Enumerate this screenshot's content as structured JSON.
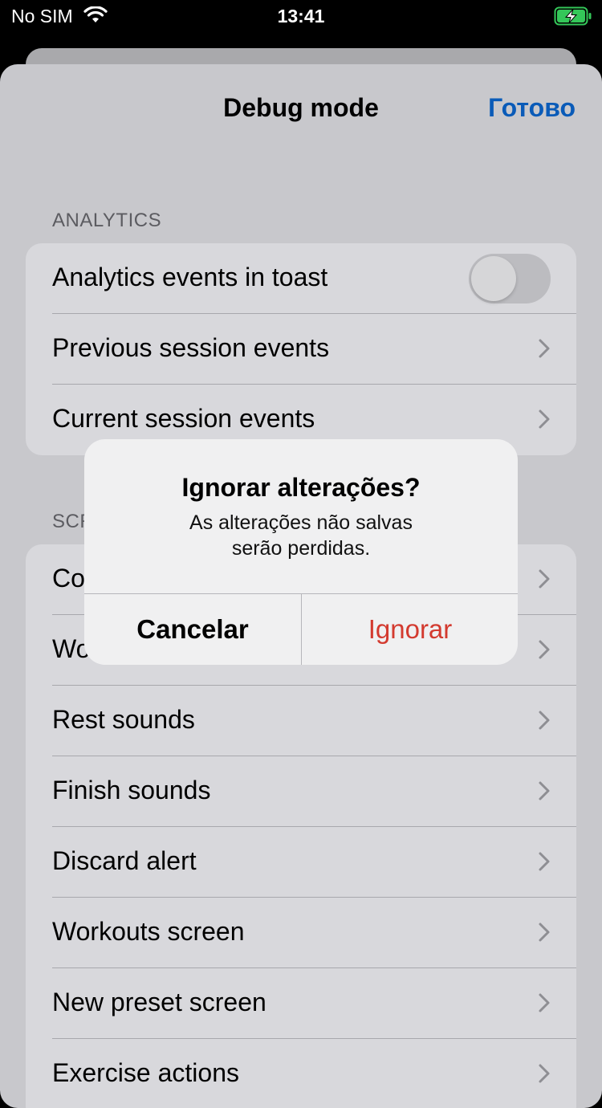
{
  "status_bar": {
    "carrier": "No SIM",
    "time": "13:41"
  },
  "nav": {
    "title": "Debug mode",
    "done_label": "Готово"
  },
  "sections": [
    {
      "header": "ANALYTICS",
      "rows": [
        {
          "label": "Analytics events in toast",
          "accessory": "toggle",
          "toggle_on": false
        },
        {
          "label": "Previous session events",
          "accessory": "chevron"
        },
        {
          "label": "Current session events",
          "accessory": "chevron"
        }
      ]
    },
    {
      "header": "SCR",
      "rows": [
        {
          "label": "Co",
          "accessory": "chevron"
        },
        {
          "label": "Wo",
          "accessory": "chevron"
        },
        {
          "label": "Rest sounds",
          "accessory": "chevron"
        },
        {
          "label": "Finish sounds",
          "accessory": "chevron"
        },
        {
          "label": "Discard alert",
          "accessory": "chevron"
        },
        {
          "label": "Workouts screen",
          "accessory": "chevron"
        },
        {
          "label": "New preset screen",
          "accessory": "chevron"
        },
        {
          "label": "Exercise actions",
          "accessory": "chevron"
        }
      ]
    }
  ],
  "alert": {
    "title": "Ignorar alterações?",
    "message_line1": "As alterações não salvas",
    "message_line2": "serão perdidas.",
    "cancel_label": "Cancelar",
    "ignore_label": "Ignorar"
  },
  "colors": {
    "accent": "#0a5bb8",
    "destructive": "#d33a2f",
    "battery_charging": "#34c759"
  }
}
